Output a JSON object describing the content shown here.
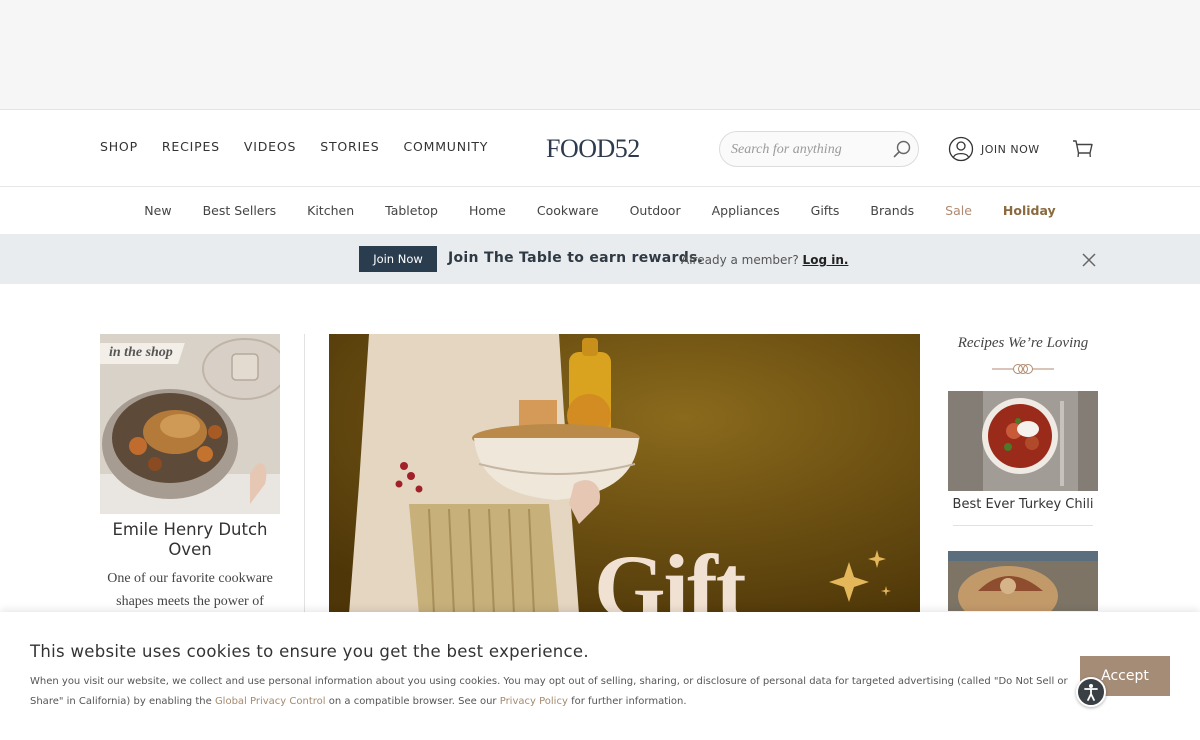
{
  "nav": {
    "shop": "SHOP",
    "recipes": "RECIPES",
    "videos": "VIDEOS",
    "stories": "STORIES",
    "community": "COMMUNITY"
  },
  "logo": "FOOD52",
  "search": {
    "placeholder": "Search for anything",
    "icon": "search-icon"
  },
  "account": {
    "join": "JOIN NOW",
    "icon": "user-icon"
  },
  "cart": {
    "icon": "cart-icon"
  },
  "subnav": [
    "New",
    "Best Sellers",
    "Kitchen",
    "Tabletop",
    "Home",
    "Cookware",
    "Outdoor",
    "Appliances",
    "Gifts",
    "Brands",
    "Sale",
    "Holiday"
  ],
  "rewards": {
    "button": "Join Now",
    "headline": "Join The Table to earn rewards.",
    "member_text": "Already a member?",
    "login": "Log in."
  },
  "shop_card": {
    "tag": "in the shop",
    "title": "Emile Henry Dutch Oven",
    "description": "One of our favorite cookware shapes meets the power of"
  },
  "hero": {
    "text": "Gift"
  },
  "recipes_panel": {
    "heading": "Recipes We’re Loving",
    "items": [
      {
        "title": "Best Ever Turkey Chili"
      }
    ]
  },
  "cookie": {
    "title": "This website uses cookies to ensure you get the best experience.",
    "body_1": "When you visit our website, we collect and use personal information about you using cookies. You may opt out of selling, sharing, or disclosure of personal data for targeted advertising (called \"Do Not Sell or Share\" in California) by enabling the",
    "gpc_link": "Global Privacy Control",
    "body_2": "on a compatible browser. See our",
    "privacy_link": "Privacy Policy",
    "body_3": "for further information.",
    "accept": "Accept"
  },
  "colors": {
    "brand_navy": "#2e3b4e",
    "join_button": "#2a3d4f",
    "sale": "#b08a70",
    "holiday": "#8a6a3f",
    "accept": "#a58c76",
    "link_tan": "#a58a6e"
  }
}
